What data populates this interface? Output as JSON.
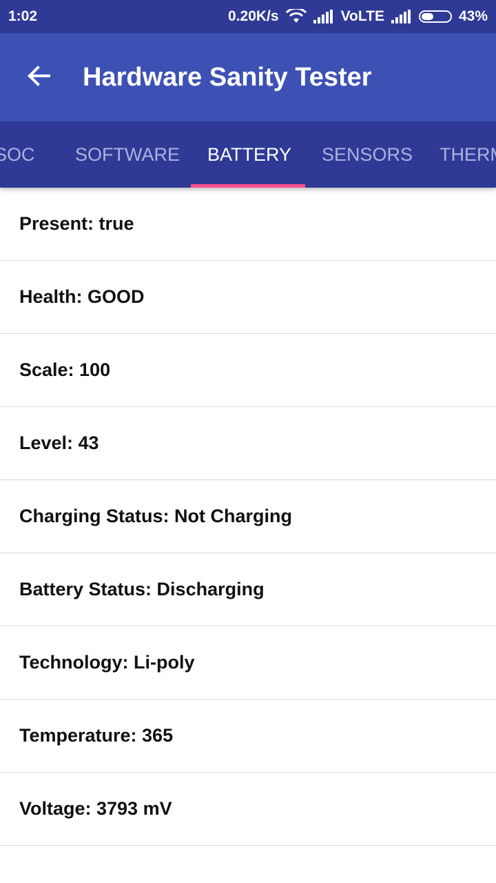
{
  "status_bar": {
    "time": "1:02",
    "net_speed": "0.20K/s",
    "network": "VoLTE",
    "battery_percent": "43%",
    "battery_level": 0.43
  },
  "app_bar": {
    "title": "Hardware Sanity Tester",
    "back_icon": "arrow-back-icon"
  },
  "tabs": [
    {
      "label": "SOC",
      "active": false
    },
    {
      "label": "SOFTWARE",
      "active": false
    },
    {
      "label": "BATTERY",
      "active": true
    },
    {
      "label": "SENSORS",
      "active": false
    },
    {
      "label": "THERMAL",
      "active": false
    }
  ],
  "colors": {
    "status_bar": "#2f3a96",
    "app_bar": "#3d51b4",
    "tab_bar": "#2f3a96",
    "indicator": "#ff4f8f"
  },
  "battery_info": [
    {
      "text": "Present: true"
    },
    {
      "text": "Health: GOOD"
    },
    {
      "text": "Scale: 100"
    },
    {
      "text": "Level: 43"
    },
    {
      "text": "Charging Status: Not Charging"
    },
    {
      "text": "Battery Status: Discharging"
    },
    {
      "text": "Technology: Li-poly"
    },
    {
      "text": "Temperature: 365"
    },
    {
      "text": "Voltage: 3793 mV"
    }
  ]
}
